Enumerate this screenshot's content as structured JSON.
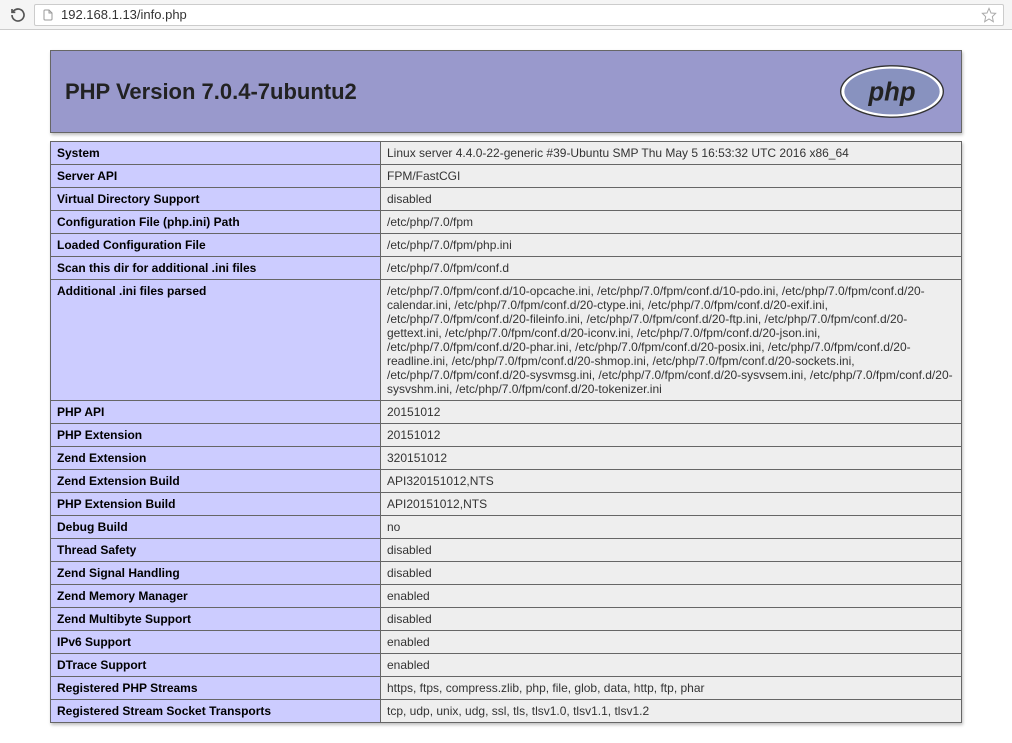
{
  "browser": {
    "url": "192.168.1.13/info.php"
  },
  "header": {
    "title": "PHP Version 7.0.4-7ubuntu2"
  },
  "rows": [
    {
      "key": "System",
      "val": "Linux server 4.4.0-22-generic #39-Ubuntu SMP Thu May 5 16:53:32 UTC 2016 x86_64"
    },
    {
      "key": "Server API",
      "val": "FPM/FastCGI"
    },
    {
      "key": "Virtual Directory Support",
      "val": "disabled"
    },
    {
      "key": "Configuration File (php.ini) Path",
      "val": "/etc/php/7.0/fpm"
    },
    {
      "key": "Loaded Configuration File",
      "val": "/etc/php/7.0/fpm/php.ini"
    },
    {
      "key": "Scan this dir for additional .ini files",
      "val": "/etc/php/7.0/fpm/conf.d"
    },
    {
      "key": "Additional .ini files parsed",
      "val": "/etc/php/7.0/fpm/conf.d/10-opcache.ini, /etc/php/7.0/fpm/conf.d/10-pdo.ini, /etc/php/7.0/fpm/conf.d/20-calendar.ini, /etc/php/7.0/fpm/conf.d/20-ctype.ini, /etc/php/7.0/fpm/conf.d/20-exif.ini, /etc/php/7.0/fpm/conf.d/20-fileinfo.ini, /etc/php/7.0/fpm/conf.d/20-ftp.ini, /etc/php/7.0/fpm/conf.d/20-gettext.ini, /etc/php/7.0/fpm/conf.d/20-iconv.ini, /etc/php/7.0/fpm/conf.d/20-json.ini, /etc/php/7.0/fpm/conf.d/20-phar.ini, /etc/php/7.0/fpm/conf.d/20-posix.ini, /etc/php/7.0/fpm/conf.d/20-readline.ini, /etc/php/7.0/fpm/conf.d/20-shmop.ini, /etc/php/7.0/fpm/conf.d/20-sockets.ini, /etc/php/7.0/fpm/conf.d/20-sysvmsg.ini, /etc/php/7.0/fpm/conf.d/20-sysvsem.ini, /etc/php/7.0/fpm/conf.d/20-sysvshm.ini, /etc/php/7.0/fpm/conf.d/20-tokenizer.ini"
    },
    {
      "key": "PHP API",
      "val": "20151012"
    },
    {
      "key": "PHP Extension",
      "val": "20151012"
    },
    {
      "key": "Zend Extension",
      "val": "320151012"
    },
    {
      "key": "Zend Extension Build",
      "val": "API320151012,NTS"
    },
    {
      "key": "PHP Extension Build",
      "val": "API20151012,NTS"
    },
    {
      "key": "Debug Build",
      "val": "no"
    },
    {
      "key": "Thread Safety",
      "val": "disabled"
    },
    {
      "key": "Zend Signal Handling",
      "val": "disabled"
    },
    {
      "key": "Zend Memory Manager",
      "val": "enabled"
    },
    {
      "key": "Zend Multibyte Support",
      "val": "disabled"
    },
    {
      "key": "IPv6 Support",
      "val": "enabled"
    },
    {
      "key": "DTrace Support",
      "val": "enabled"
    },
    {
      "key": "Registered PHP Streams",
      "val": "https, ftps, compress.zlib, php, file, glob, data, http, ftp, phar"
    },
    {
      "key": "Registered Stream Socket Transports",
      "val": "tcp, udp, unix, udg, ssl, tls, tlsv1.0, tlsv1.1, tlsv1.2"
    }
  ]
}
